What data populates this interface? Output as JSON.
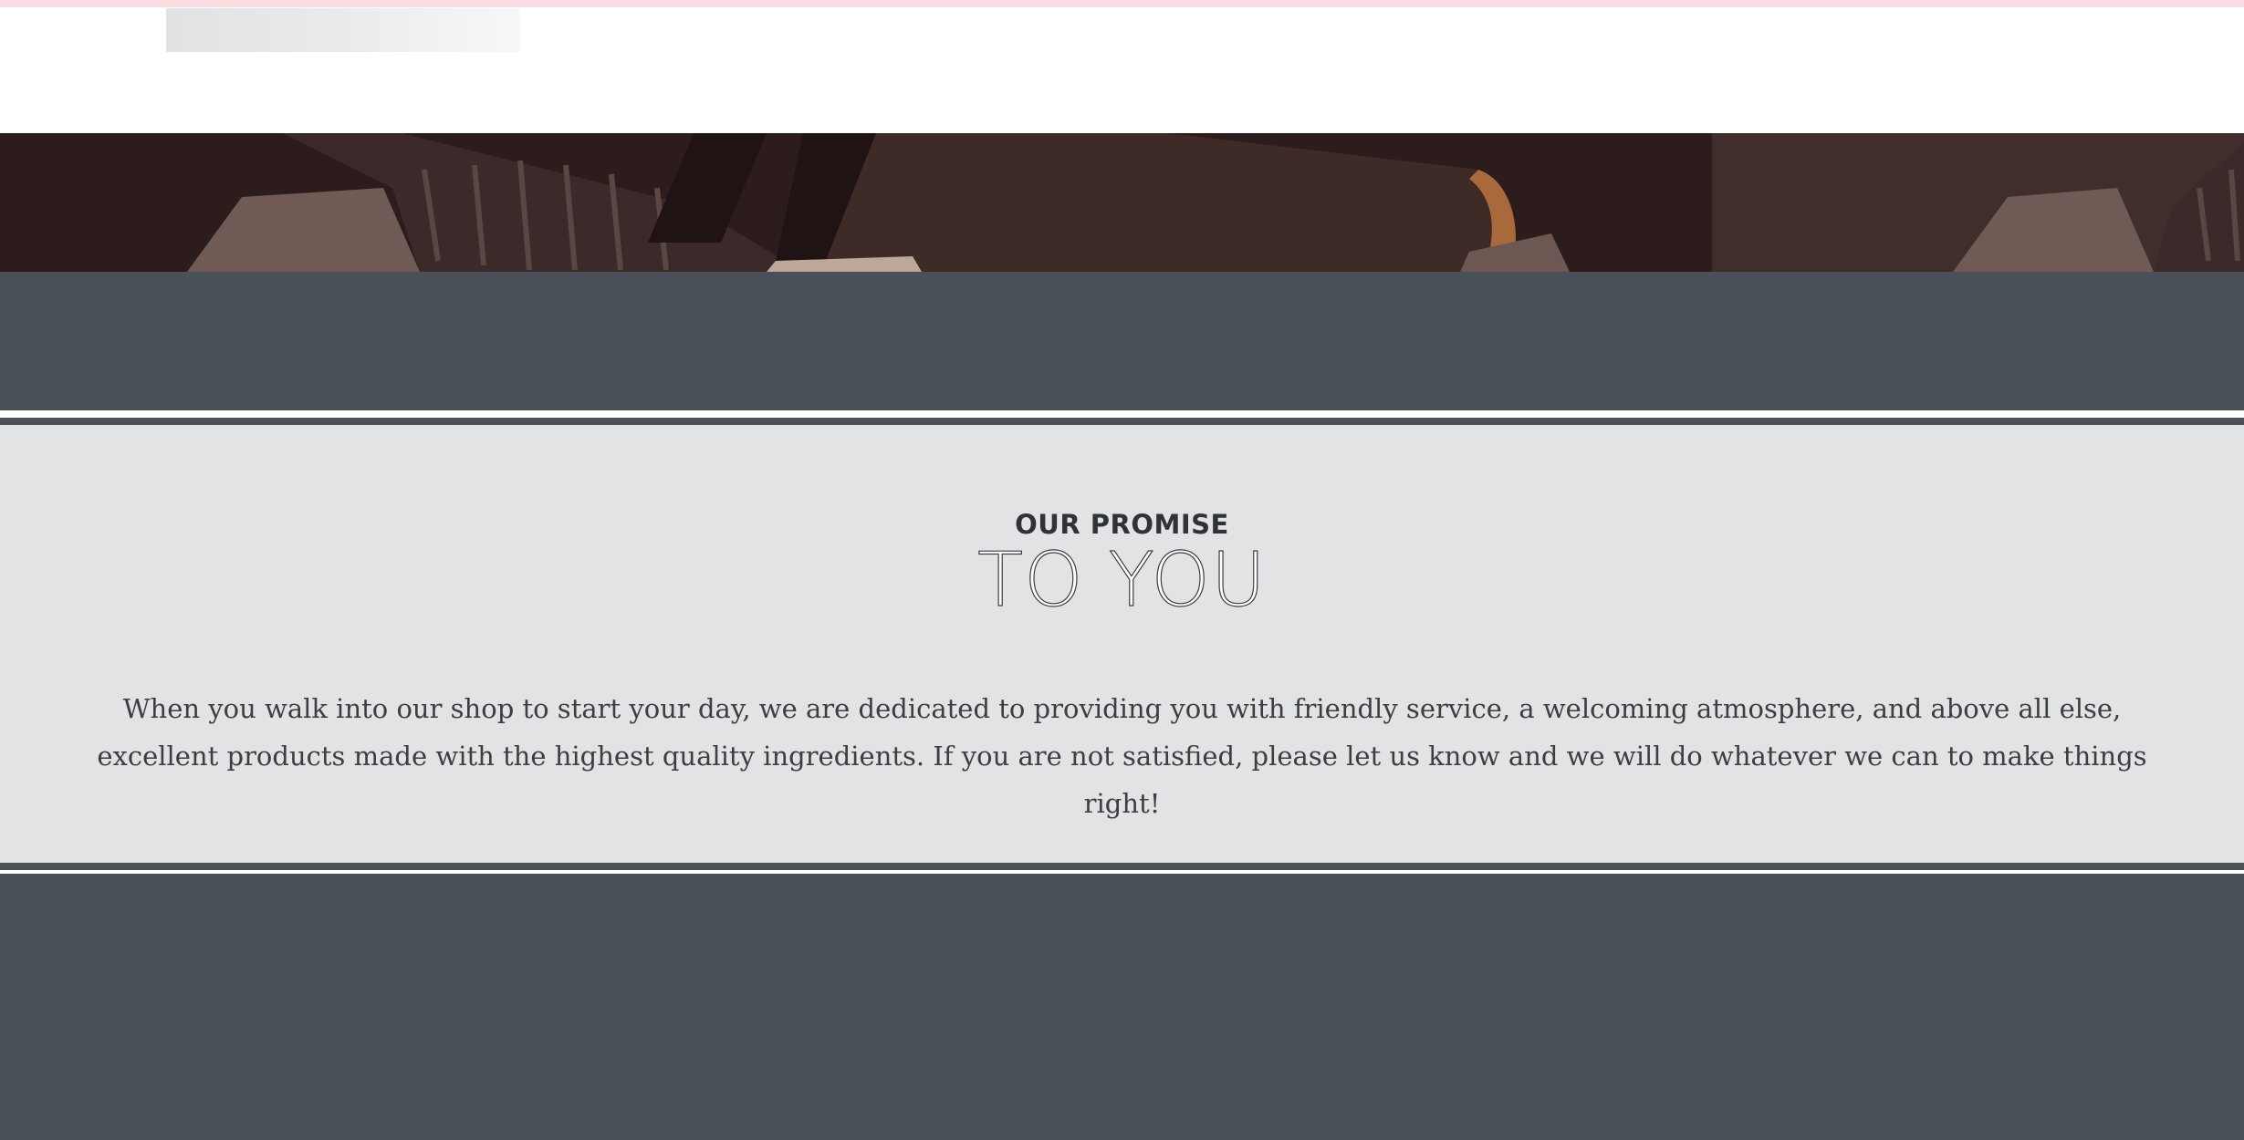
{
  "colors": {
    "top_strip": "#fbdde4",
    "header_bg": "#ffffff",
    "dark_band": "#4a5058",
    "promise_bg": "#e2e3e5",
    "text": "#3b3f44"
  },
  "header": {
    "logo": "logo-placeholder"
  },
  "banner": {
    "image": "shoe-photo"
  },
  "promise": {
    "kicker": "OUR PROMISE",
    "headline": "TO YOU",
    "body": "When you walk into our shop to start your day, we are dedicated to providing you with friendly service, a welcoming atmosphere, and above all else, excellent products made with the highest quality ingredients. If you are not satisfied, please let us know and we will do whatever we can to make things right!"
  }
}
